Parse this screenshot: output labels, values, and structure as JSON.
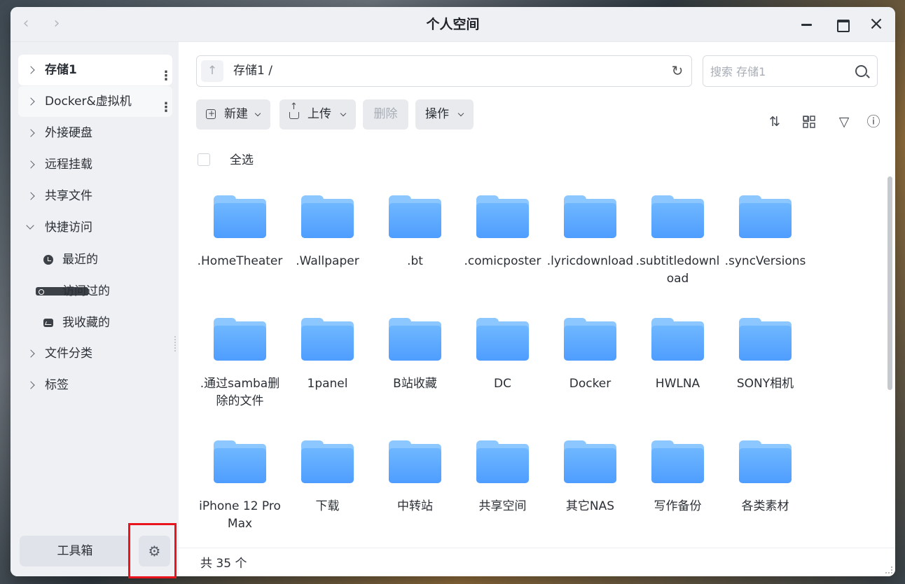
{
  "window": {
    "title": "个人空间",
    "back_icon": "chevron-left-icon",
    "forward_icon": "chevron-right-icon",
    "close_glyph": "×"
  },
  "sidebar": {
    "items": [
      {
        "label": "存储1",
        "expanded": false,
        "has_menu": true,
        "active": true
      },
      {
        "label": "Docker&虚拟机",
        "expanded": false,
        "has_menu": true,
        "active": false
      },
      {
        "label": "外接硬盘",
        "expanded": false
      },
      {
        "label": "远程挂载",
        "expanded": false
      },
      {
        "label": "共享文件",
        "expanded": false
      },
      {
        "label": "快捷访问",
        "expanded": true
      },
      {
        "label": "文件分类",
        "expanded": false
      },
      {
        "label": "标签",
        "expanded": false
      }
    ],
    "quick_access": [
      {
        "label": "最近的",
        "icon": "clock-icon"
      },
      {
        "label": "访问过的",
        "icon": "visited-folder-icon"
      },
      {
        "label": "我收藏的",
        "icon": "favorite-folder-icon"
      }
    ],
    "toolbox_label": "工具箱",
    "settings_icon": "gear-icon",
    "settings_glyph": "⚙"
  },
  "highlight_color": "#e8151e",
  "pathbar": {
    "up_glyph": "↑",
    "path": "存储1 /",
    "refresh_glyph": "↻"
  },
  "search": {
    "placeholder": "搜索 存储1",
    "value": ""
  },
  "toolbar": {
    "new_label": "新建",
    "upload_label": "上传",
    "delete_label": "删除",
    "action_label": "操作"
  },
  "view_icons": {
    "sort_glyph": "⇅",
    "filter_glyph": "▽",
    "info_glyph": "ⓘ"
  },
  "select_all_label": "全选",
  "folder_color": "#4e9dff",
  "folders": [
    ".HomeTheater",
    ".Wallpaper",
    ".bt",
    ".comicposter",
    ".lyricdownload",
    ".subtitledownload",
    ".syncVersions",
    ".通过samba删除的文件",
    "1panel",
    "B站收藏",
    "DC",
    "Docker",
    "HWLNA",
    "SONY相机",
    "iPhone 12 Pro Max",
    "下载",
    "中转站",
    "共享空间",
    "其它NAS",
    "写作备份",
    "各类素材"
  ],
  "footer": {
    "count_text": "共 35 个"
  }
}
